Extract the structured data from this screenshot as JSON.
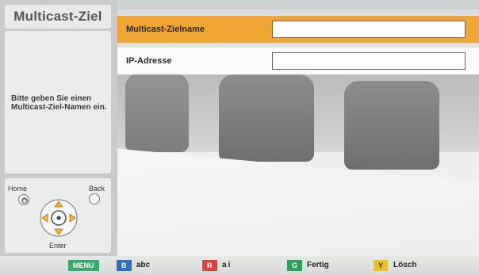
{
  "screen": {
    "title": "Multicast-Ziel",
    "help_text": "Bitte geben Sie einen Multicast-Ziel-Namen ein."
  },
  "remote": {
    "home_label": "Home",
    "back_label": "Back",
    "enter_label": "Enter"
  },
  "form": {
    "fields": [
      {
        "label": "Multicast-Zielname",
        "value": "",
        "selected": true
      },
      {
        "label": "IP-Adresse",
        "value": "",
        "selected": false
      }
    ]
  },
  "bottom_bar": {
    "keys": [
      {
        "key": "MENU",
        "label": "",
        "color": "#3aa86b"
      },
      {
        "key": "B",
        "label": "abc",
        "color": "#2a6fc0"
      },
      {
        "key": "R",
        "label": "a i",
        "color": "#e04040"
      },
      {
        "key": "G",
        "label": "Fertig",
        "color": "#2f9f5e"
      },
      {
        "key": "Y",
        "label": "Lösch",
        "color": "#e6c22a"
      }
    ]
  },
  "colors": {
    "selected_row": "#f0a632",
    "accent": "#f0a632"
  }
}
